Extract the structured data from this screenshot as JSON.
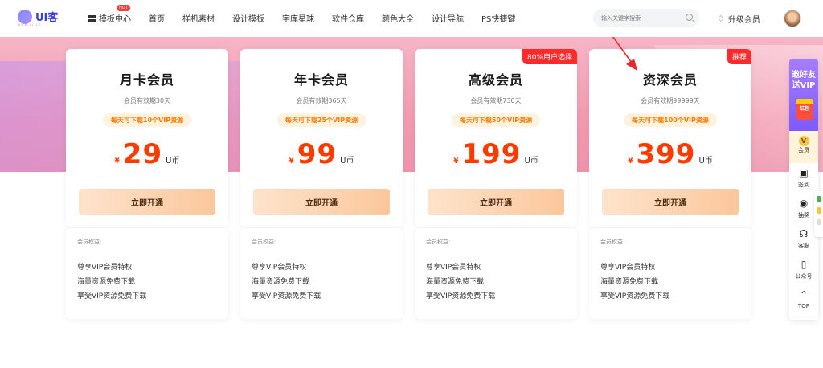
{
  "header": {
    "logo_text": "UI客",
    "logo_sub": "www.ui.cn",
    "nav": [
      {
        "label": "模板中心",
        "badge": "HOT"
      },
      {
        "label": "首页"
      },
      {
        "label": "样机素材"
      },
      {
        "label": "设计模板"
      },
      {
        "label": "字库星球"
      },
      {
        "label": "软件仓库"
      },
      {
        "label": "颜色大全"
      },
      {
        "label": "设计导航"
      },
      {
        "label": "PS快捷键"
      }
    ],
    "search_placeholder": "输入关键字搜索",
    "upgrade_label": "升级会员"
  },
  "cards": [
    {
      "title": "月卡会员",
      "period": "会员有效期30天",
      "quota": "每天可下载10个VIP资源",
      "currency": "¥",
      "amount": "29",
      "unit": "U币",
      "button": "立即开通",
      "badge": ""
    },
    {
      "title": "年卡会员",
      "period": "会员有效期365天",
      "quota": "每天可下载25个VIP资源",
      "currency": "¥",
      "amount": "99",
      "unit": "U币",
      "button": "立即开通",
      "badge": ""
    },
    {
      "title": "高级会员",
      "period": "会员有效期730天",
      "quota": "每天可下载50个VIP资源",
      "currency": "¥",
      "amount": "199",
      "unit": "U币",
      "button": "立即开通",
      "badge": "80%用户选择"
    },
    {
      "title": "资深会员",
      "period": "会员有效期99999天",
      "quota": "每天可下载100个VIP资源",
      "currency": "¥",
      "amount": "399",
      "unit": "U币",
      "button": "立即开通",
      "badge": "推荐"
    }
  ],
  "benefits": {
    "heading": "会员权益:",
    "items": [
      "尊享VIP会员特权",
      "海量资源免费下载",
      "享受VIP资源免费下载"
    ]
  },
  "sidebar": {
    "invite_line1": "邀好友",
    "invite_line2": "送VIP",
    "redpack_label": "红包",
    "vip_icon": "V",
    "vip_label": "会员",
    "items": [
      "签到",
      "抽奖",
      "客服",
      "公众号",
      "TOP"
    ]
  },
  "colors": {
    "accent": "#ff3a00",
    "badge_red": "#ff2b2b",
    "banner_pink": "#f29ab0"
  }
}
